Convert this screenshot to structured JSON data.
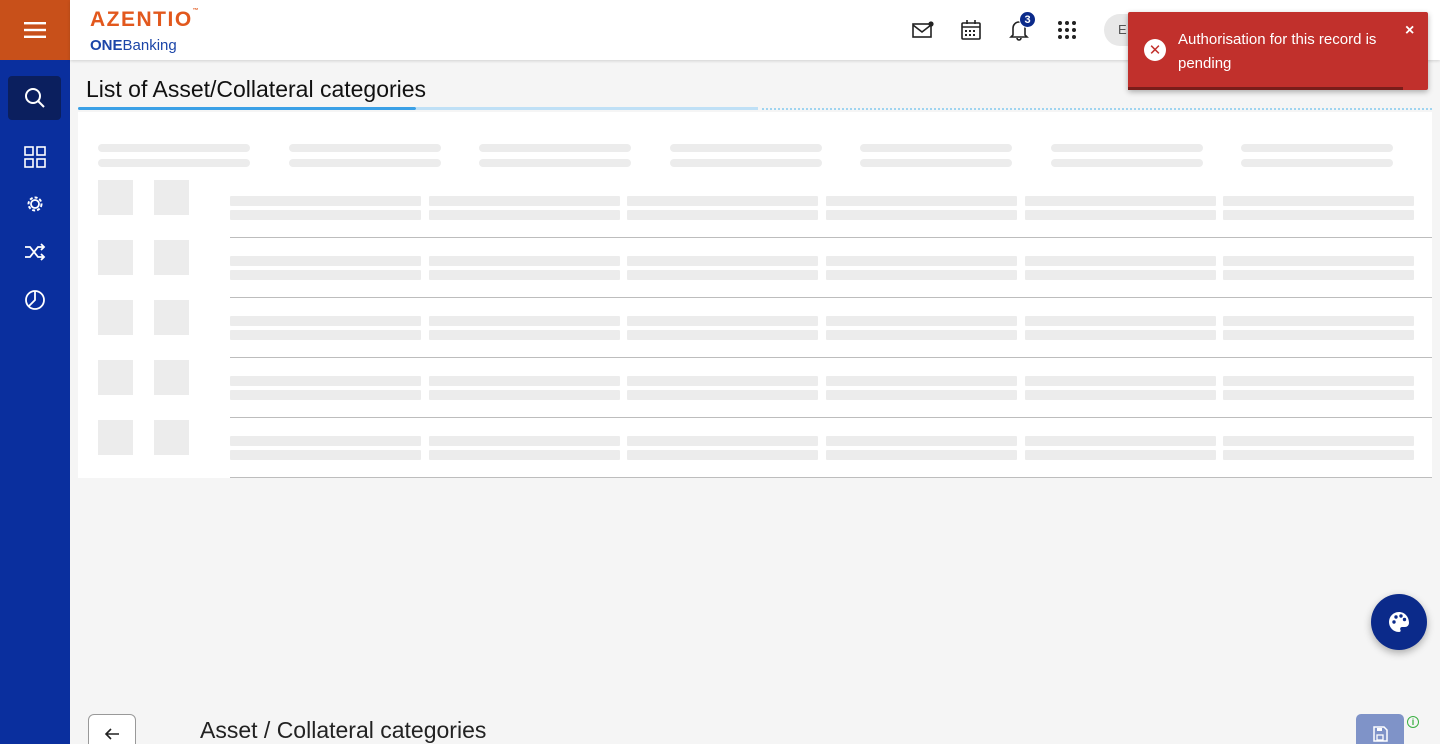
{
  "brand": {
    "name": "AZENTIO",
    "tm": "™",
    "sub_bold": "ONE",
    "sub_rest": "Banking"
  },
  "header": {
    "notification_count": "3",
    "lang_initial": "E"
  },
  "sidebar": {
    "items": [
      {
        "name": "search",
        "icon": "search-icon",
        "active": true
      },
      {
        "name": "dashboard",
        "icon": "grid-icon"
      },
      {
        "name": "settings",
        "icon": "gear-icon"
      },
      {
        "name": "transfers",
        "icon": "shuffle-icon"
      },
      {
        "name": "reports",
        "icon": "pie-chart-icon"
      }
    ]
  },
  "toast": {
    "message": "Authorisation for this record is pending",
    "close": "×",
    "status": "error"
  },
  "page": {
    "title": "List of Asset/Collateral categories",
    "state": "loading-skeleton"
  },
  "footer": {
    "title": "Asset / Collateral categories",
    "info": "i"
  },
  "colors": {
    "sidebar": "#0a2f9e",
    "brand_orange": "#e2581d",
    "hamburger": "#c8501a",
    "toast": "#c1302c",
    "accent": "#3aa0e6"
  }
}
